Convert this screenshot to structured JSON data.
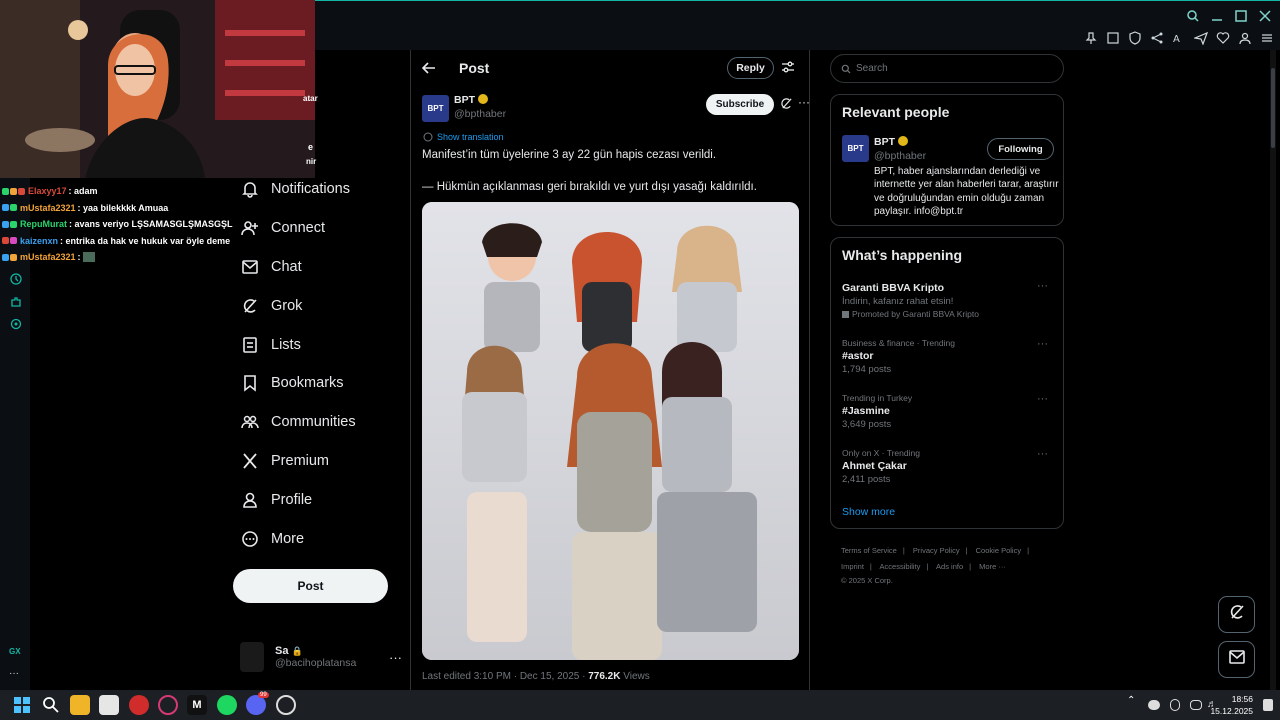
{
  "browser": {
    "accent": "#13b5a3"
  },
  "stream_chat": [
    {
      "user": "Elaxyy17",
      "user_color": "#d9493a",
      "msg": ": adam"
    },
    {
      "user": "mUstafa2321",
      "user_color": "#f2a33a",
      "msg": ": yaa bilekkkk Amuaa"
    },
    {
      "user": "RepuMurat",
      "user_color": "#2bd36b",
      "msg": ": avans veriyo LŞSAMASGLŞMASGŞL"
    },
    {
      "user": "kaizenxn",
      "user_color": "#3aa0f2",
      "msg": ": entrika da hak ve hukuk var öyle deme"
    },
    {
      "user": "mUstafa2321",
      "user_color": "#f2a33a",
      "msg": ": "
    }
  ],
  "overlay_fragments": {
    "line1": "atar",
    "line2": "e",
    "line3": "nir"
  },
  "nav": {
    "items": [
      {
        "label": "Notifications",
        "icon": "bell-icon"
      },
      {
        "label": "Connect",
        "icon": "add-person-icon"
      },
      {
        "label": "Chat",
        "icon": "mail-icon"
      },
      {
        "label": "Grok",
        "icon": "grok-icon"
      },
      {
        "label": "Lists",
        "icon": "list-icon"
      },
      {
        "label": "Bookmarks",
        "icon": "bookmark-icon"
      },
      {
        "label": "Communities",
        "icon": "communities-icon"
      },
      {
        "label": "Premium",
        "icon": "x-logo-icon"
      },
      {
        "label": "Profile",
        "icon": "person-icon"
      },
      {
        "label": "More",
        "icon": "more-circle-icon"
      }
    ],
    "post_label": "Post"
  },
  "account": {
    "name": "Sa",
    "handle": "@bacihoplatansa",
    "more": "···"
  },
  "post": {
    "header_title": "Post",
    "reply_label": "Reply",
    "author_name": "BPT",
    "author_handle": "@bpthaber",
    "logo_text": "BPT",
    "subscribe_label": "Subscribe",
    "more": "···",
    "show_translation": "Show translation",
    "text_line1": "Manifest’in tüm üyelerine 3 ay 22 gün hapis cezası verildi.",
    "text_line2": "— Hükmün açıklanması geri bırakıldı ve yurt dışı yasağı kaldırıldı.",
    "meta_prefix": "Last edited 3:10 PM · Dec 15, 2025 · ",
    "views_count": "776.2K",
    "views_label": " Views"
  },
  "right": {
    "search_placeholder": "Search",
    "relevant_title": "Relevant people",
    "rp_name": "BPT",
    "rp_handle": "@bpthaber",
    "rp_logo": "BPT",
    "rp_follow": "Following",
    "rp_bio": "BPT, haber ajanslarından derlediği ve internette yer alan haberleri tarar, araştırır ve doğruluğundan emin olduğu zaman paylaşır. info@bpt.tr",
    "happening_title": "What’s happening",
    "trends": [
      {
        "top": "",
        "name": "Garanti BBVA Kripto",
        "sub": "İndirin, kafanız rahat etsin!",
        "promo": "Promoted by Garanti BBVA Kripto"
      },
      {
        "top": "Business & finance · Trending",
        "name": "#astor",
        "sub": "1,794 posts",
        "promo": ""
      },
      {
        "top": "Trending in Turkey",
        "name": "#Jasmine",
        "sub": "3,649 posts",
        "promo": ""
      },
      {
        "top": "Only on X · Trending",
        "name": "Ahmet Çakar",
        "sub": "2,411 posts",
        "promo": ""
      }
    ],
    "trend_more": "···",
    "show_more": "Show more",
    "footer_links": [
      "Terms of Service",
      "|",
      "Privacy Policy",
      "|",
      "Cookie Policy",
      "|"
    ],
    "footer_links2": [
      "Imprint",
      "|",
      "Accessibility",
      "|",
      "Ads info",
      "|",
      "More ···"
    ],
    "copyright": "© 2025 X Corp."
  },
  "taskbar": {
    "time": "18:56",
    "date": "15.12.2025",
    "discord_badge": "99"
  }
}
